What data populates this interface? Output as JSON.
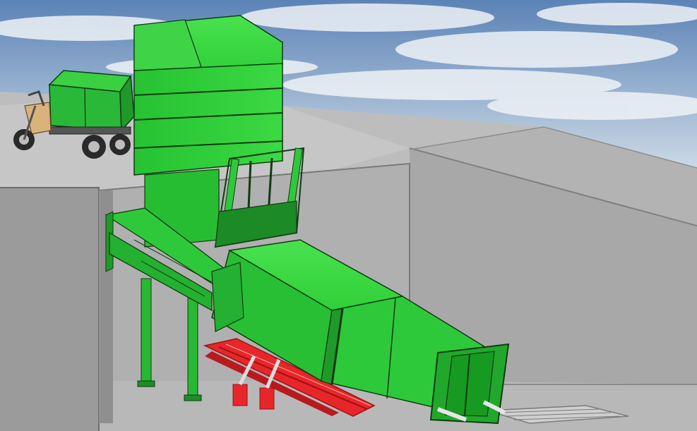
{
  "scene": {
    "description_visible_text": "",
    "colors": {
      "sky_top": "#5f86b8",
      "sky_mid": "#a9bfd8",
      "cloud": "#eef2f6",
      "concrete_light": "#c4c4c4",
      "concrete_mid": "#a9a9a9",
      "concrete_dark": "#8c8c8c",
      "pit_floor": "#b8b8b8",
      "green_main": "#2ec93a",
      "green_light": "#43dc4a",
      "green_dark": "#179a22",
      "green_shadow": "#0f6e17",
      "outline": "#103a12",
      "red_frame": "#e8262a",
      "red_dark": "#9c1214",
      "tricycle_body": "#2ab838",
      "motorcycle_tan": "#d9b27c",
      "wheel": "#2a2a2a"
    },
    "icons": [
      "tricycle-truck-icon",
      "compactor-container-icon",
      "hopper-tower-icon"
    ]
  }
}
